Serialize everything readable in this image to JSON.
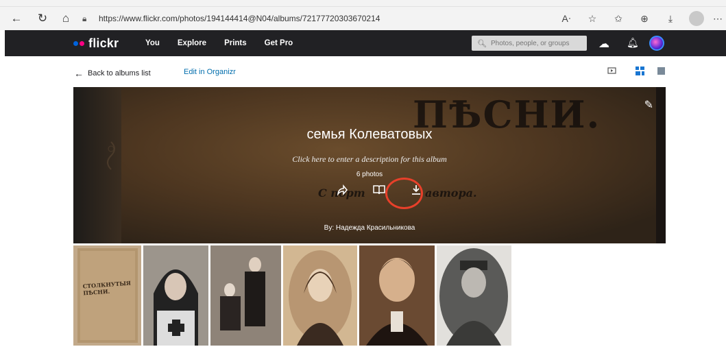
{
  "browser": {
    "url": "https://www.flickr.com/photos/194144414@N04/albums/72177720303670214"
  },
  "header": {
    "logo": "flickr",
    "nav": [
      "You",
      "Explore",
      "Prints",
      "Get Pro"
    ],
    "search_placeholder": "Photos, people, or groups"
  },
  "subnav": {
    "back_label": "Back to albums list",
    "edit_label": "Edit in Organizr"
  },
  "album": {
    "title": "семья Колеватовых",
    "description_prompt": "Click here to enter a description for this album",
    "photo_count": "6 photos",
    "byline": "By: Надежда Красильникова",
    "cover_words": [
      "ПѢСНИ.",
      "С порт",
      "автора."
    ]
  },
  "photos": [
    {
      "name": "photo-1",
      "caption": "СТОЛКНУТЫЯ ПѢСНИ."
    },
    {
      "name": "photo-2"
    },
    {
      "name": "photo-3"
    },
    {
      "name": "photo-4"
    },
    {
      "name": "photo-5"
    },
    {
      "name": "photo-6"
    }
  ],
  "colors": {
    "flickr_blue": "#0063dc",
    "flickr_pink": "#ff0084",
    "header_bg": "#212124",
    "link": "#006dac",
    "highlight_circle": "#e8402a"
  },
  "icons": [
    "back-icon",
    "reload-icon",
    "home-icon",
    "lock-icon",
    "read-aloud-icon",
    "favorite-icon",
    "favorites-icon",
    "collections-icon",
    "download-icon",
    "profile-icon",
    "more-icon",
    "search-icon",
    "upload-icon",
    "bell-icon",
    "slideshow-icon",
    "grid-view-icon",
    "single-view-icon",
    "pencil-icon",
    "share-icon",
    "book-icon",
    "download-album-icon"
  ]
}
